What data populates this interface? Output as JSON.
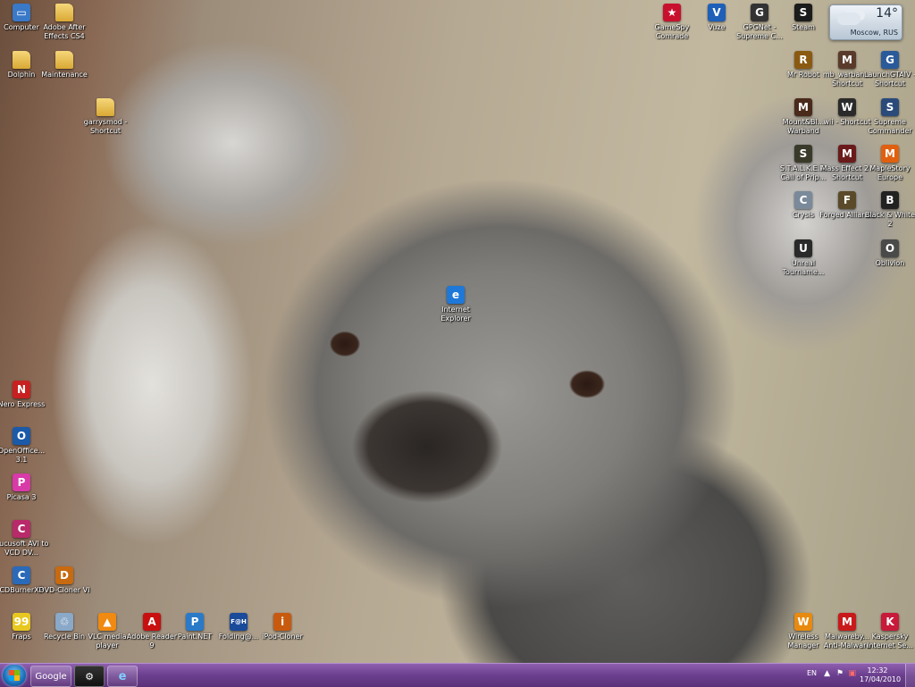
{
  "desktop": {
    "icons": [
      {
        "label": "Computer",
        "color": "#3a78c8",
        "glyph": "▭"
      },
      {
        "label": "Adobe After Effects CS4",
        "color": "folder",
        "glyph": ""
      },
      {
        "label": "Dolphin",
        "color": "folder",
        "glyph": ""
      },
      {
        "label": "Maintenance",
        "color": "folder",
        "glyph": ""
      },
      {
        "label": "garrysmod - Shortcut",
        "color": "folder",
        "glyph": ""
      },
      {
        "label": "GameSpy Comrade",
        "color": "#c8102e",
        "glyph": "★"
      },
      {
        "label": "Vuze",
        "color": "#1e5fb8",
        "glyph": "V"
      },
      {
        "label": "GPGNet - Supreme C...",
        "color": "#333333",
        "glyph": "G"
      },
      {
        "label": "Steam",
        "color": "#1b1b1b",
        "glyph": "S"
      },
      {
        "label": "Mr Robot",
        "color": "#8a5a12",
        "glyph": "R"
      },
      {
        "label": "mb_warban... Shortcut",
        "color": "#5a3a2a",
        "glyph": "M"
      },
      {
        "label": "LaunchGTAIV - Shortcut",
        "color": "#2a5a9a",
        "glyph": "G"
      },
      {
        "label": "Mount&Bl... Warband",
        "color": "#4a2a1a",
        "glyph": "M"
      },
      {
        "label": "wii - Shortcut",
        "color": "#2a2a2a",
        "glyph": "W"
      },
      {
        "label": "Supreme Commander",
        "color": "#2a4a7a",
        "glyph": "S"
      },
      {
        "label": "S.T.A.L.K.E.R. Call of Prip...",
        "color": "#3a3a2a",
        "glyph": "S"
      },
      {
        "label": "Mass Effect 2 - Shortcut",
        "color": "#6a1a1a",
        "glyph": "M"
      },
      {
        "label": "MapleStory Europe",
        "color": "#e06010",
        "glyph": "M"
      },
      {
        "label": "Crysis",
        "color": "#7a8a9a",
        "glyph": "C"
      },
      {
        "label": "Forged Alliance",
        "color": "#5a4a2a",
        "glyph": "F"
      },
      {
        "label": "Black & White 2",
        "color": "#222222",
        "glyph": "B"
      },
      {
        "label": "Unreal Tourname...",
        "color": "#2a2a2a",
        "glyph": "U"
      },
      {
        "label": "Oblivion",
        "color": "#4a4a4a",
        "glyph": "O"
      },
      {
        "label": "Internet Explorer",
        "color": "#1e78d8",
        "glyph": "e"
      },
      {
        "label": "Nero Express",
        "color": "#c82020",
        "glyph": "N"
      },
      {
        "label": "OpenOffice... 3.1",
        "color": "#1a5aa8",
        "glyph": "O"
      },
      {
        "label": "Picasa 3",
        "color": "#d83aa8",
        "glyph": "P"
      },
      {
        "label": "Cucusoft AVI to VCD DV...",
        "color": "#b82a6a",
        "glyph": "C"
      },
      {
        "label": "CDBurnerXP",
        "color": "#2a6ab8",
        "glyph": "C"
      },
      {
        "label": "DVD-Cloner VI",
        "color": "#c86a10",
        "glyph": "D"
      },
      {
        "label": "Fraps",
        "color": "#e8c820",
        "glyph": "99"
      },
      {
        "label": "Recycle Bin",
        "color": "#8aa8c8",
        "glyph": "♲"
      },
      {
        "label": "VLC media player",
        "color": "#f08a10",
        "glyph": "▲"
      },
      {
        "label": "Adobe Reader 9",
        "color": "#c81010",
        "glyph": "A"
      },
      {
        "label": "Paint.NET",
        "color": "#2a7ac8",
        "glyph": "P"
      },
      {
        "label": "Folding@...",
        "color": "#1a4a9a",
        "glyph": "F@H"
      },
      {
        "label": "iPod-Cloner",
        "color": "#c85a10",
        "glyph": "i"
      },
      {
        "label": "Wireless Manager",
        "color": "#e88a10",
        "glyph": "W"
      },
      {
        "label": "Malwareby... Anti-Malware",
        "color": "#c81a1a",
        "glyph": "M"
      },
      {
        "label": "Kaspersky Internet Se...",
        "color": "#c81a3a",
        "glyph": "K"
      }
    ]
  },
  "weather": {
    "temp": "14°",
    "city": "Moscow, RUS"
  },
  "taskbar": {
    "pinned": [
      {
        "label": "Google"
      },
      {
        "label": ""
      },
      {
        "label": ""
      }
    ],
    "tray": {
      "lang": "EN",
      "time": "12:32",
      "date": "17/04/2010"
    }
  }
}
